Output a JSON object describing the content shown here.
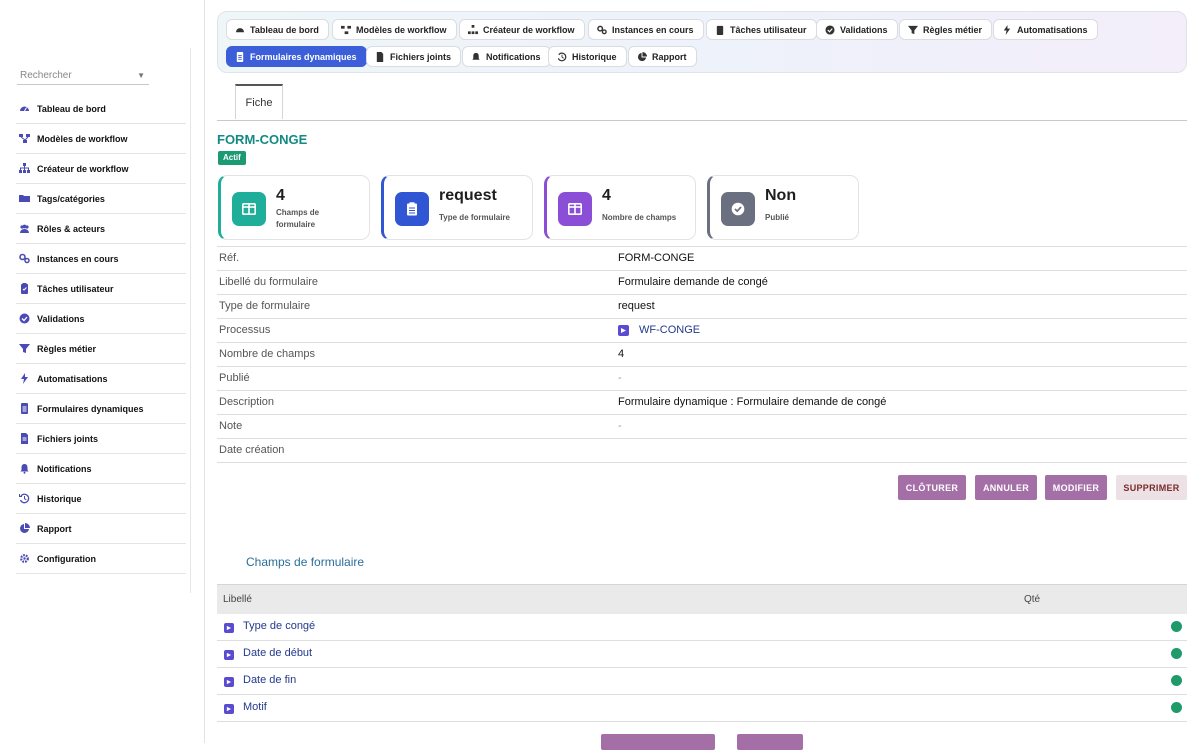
{
  "sidebar": {
    "search_placeholder": "Rechercher",
    "items": [
      {
        "label": "Tableau de bord",
        "icon": "dashboard-icon"
      },
      {
        "label": "Modèles de workflow",
        "icon": "workflow-icon"
      },
      {
        "label": "Créateur de workflow",
        "icon": "sitemap-icon"
      },
      {
        "label": "Tags/catégories",
        "icon": "folder-icon"
      },
      {
        "label": "Rôles & acteurs",
        "icon": "users-icon"
      },
      {
        "label": "Instances en cours",
        "icon": "gears-icon"
      },
      {
        "label": "Tâches utilisateur",
        "icon": "clipboard-icon"
      },
      {
        "label": "Validations",
        "icon": "check-circle-icon"
      },
      {
        "label": "Règles métier",
        "icon": "filter-icon"
      },
      {
        "label": "Automatisations",
        "icon": "bolt-icon"
      },
      {
        "label": "Formulaires dynamiques",
        "icon": "form-icon"
      },
      {
        "label": "Fichiers joints",
        "icon": "file-icon"
      },
      {
        "label": "Notifications",
        "icon": "bell-icon"
      },
      {
        "label": "Historique",
        "icon": "history-icon"
      },
      {
        "label": "Rapport",
        "icon": "pie-chart-icon"
      },
      {
        "label": "Configuration",
        "icon": "gear-icon"
      }
    ]
  },
  "topnav": {
    "row1": [
      "Tableau de bord",
      "Modèles de workflow",
      "Créateur de workflow",
      "Instances en cours",
      "Tâches utilisateur",
      "Validations",
      "Règles métier",
      "Automatisations"
    ],
    "row2": [
      "Formulaires dynamiques",
      "Fichiers joints",
      "Notifications",
      "Historique",
      "Rapport"
    ],
    "active": "Formulaires dynamiques",
    "active_color": "#3c5ed8"
  },
  "tab": {
    "label": "Fiche"
  },
  "record": {
    "ref": "FORM-CONGE",
    "status": "Actif"
  },
  "stats": [
    {
      "value": "4",
      "label": "Champs de formulaire",
      "color": "#1fae9a"
    },
    {
      "value": "request",
      "label": "Type de formulaire",
      "color": "#3056d3"
    },
    {
      "value": "4",
      "label": "Nombre de champs",
      "color": "#8a4fd6"
    },
    {
      "value": "Non",
      "label": "Publié",
      "color": "#6b7080"
    }
  ],
  "details": [
    {
      "key": "Réf.",
      "value": "FORM-CONGE"
    },
    {
      "key": "Libellé du formulaire",
      "value": "Formulaire demande de congé"
    },
    {
      "key": "Type de formulaire",
      "value": "request"
    },
    {
      "key": "Processus",
      "value": "WF-CONGE"
    },
    {
      "key": "Nombre de champs",
      "value": "4"
    },
    {
      "key": "Publié",
      "value": "-"
    },
    {
      "key": "Description",
      "value": "Formulaire dynamique : Formulaire demande de congé"
    },
    {
      "key": "Note",
      "value": "-"
    },
    {
      "key": "Date création",
      "value": ""
    }
  ],
  "actions": {
    "close": "CLÔTURER",
    "cancel": "ANNULER",
    "edit": "MODIFIER",
    "delete": "SUPPRIMER"
  },
  "fields_section": {
    "title": "Champs de formulaire",
    "col_label": "Libellé",
    "col_qty": "Qté",
    "rows": [
      "Type de congé",
      "Date de début",
      "Date de fin",
      "Motif"
    ]
  }
}
